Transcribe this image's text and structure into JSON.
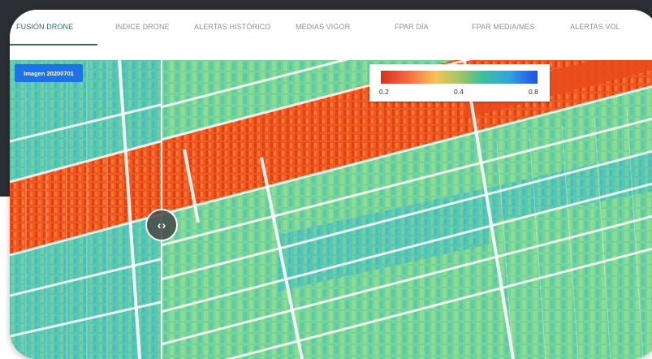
{
  "tabs": [
    {
      "label": "FUSIÓN DRONE",
      "active": true
    },
    {
      "label": "INDICE DRONE",
      "active": false
    },
    {
      "label": "ALERTAS HISTÓRICO",
      "active": false
    },
    {
      "label": "MEDIAS VIGOR",
      "active": false
    },
    {
      "label": "FPAR DÍA",
      "active": false
    },
    {
      "label": "FPAR MEDIA/MES",
      "active": false
    },
    {
      "label": "ALERTAS VOL",
      "active": false
    }
  ],
  "map": {
    "image_badge": "Imagen 20200701",
    "legend": {
      "ticks": [
        "0.2",
        "0.4",
        "0.8"
      ],
      "colors": [
        "#d7301f",
        "#f46d43",
        "#f7c25a",
        "#a3c664",
        "#3cbf9a",
        "#33a3e0",
        "#1f4fe5"
      ]
    },
    "compare_handle_icon": "chevron-left-right-icon"
  },
  "colors": {
    "accent": "#2e6d6a",
    "badge": "#1d73e6",
    "background_dark": "#2b2e34"
  }
}
